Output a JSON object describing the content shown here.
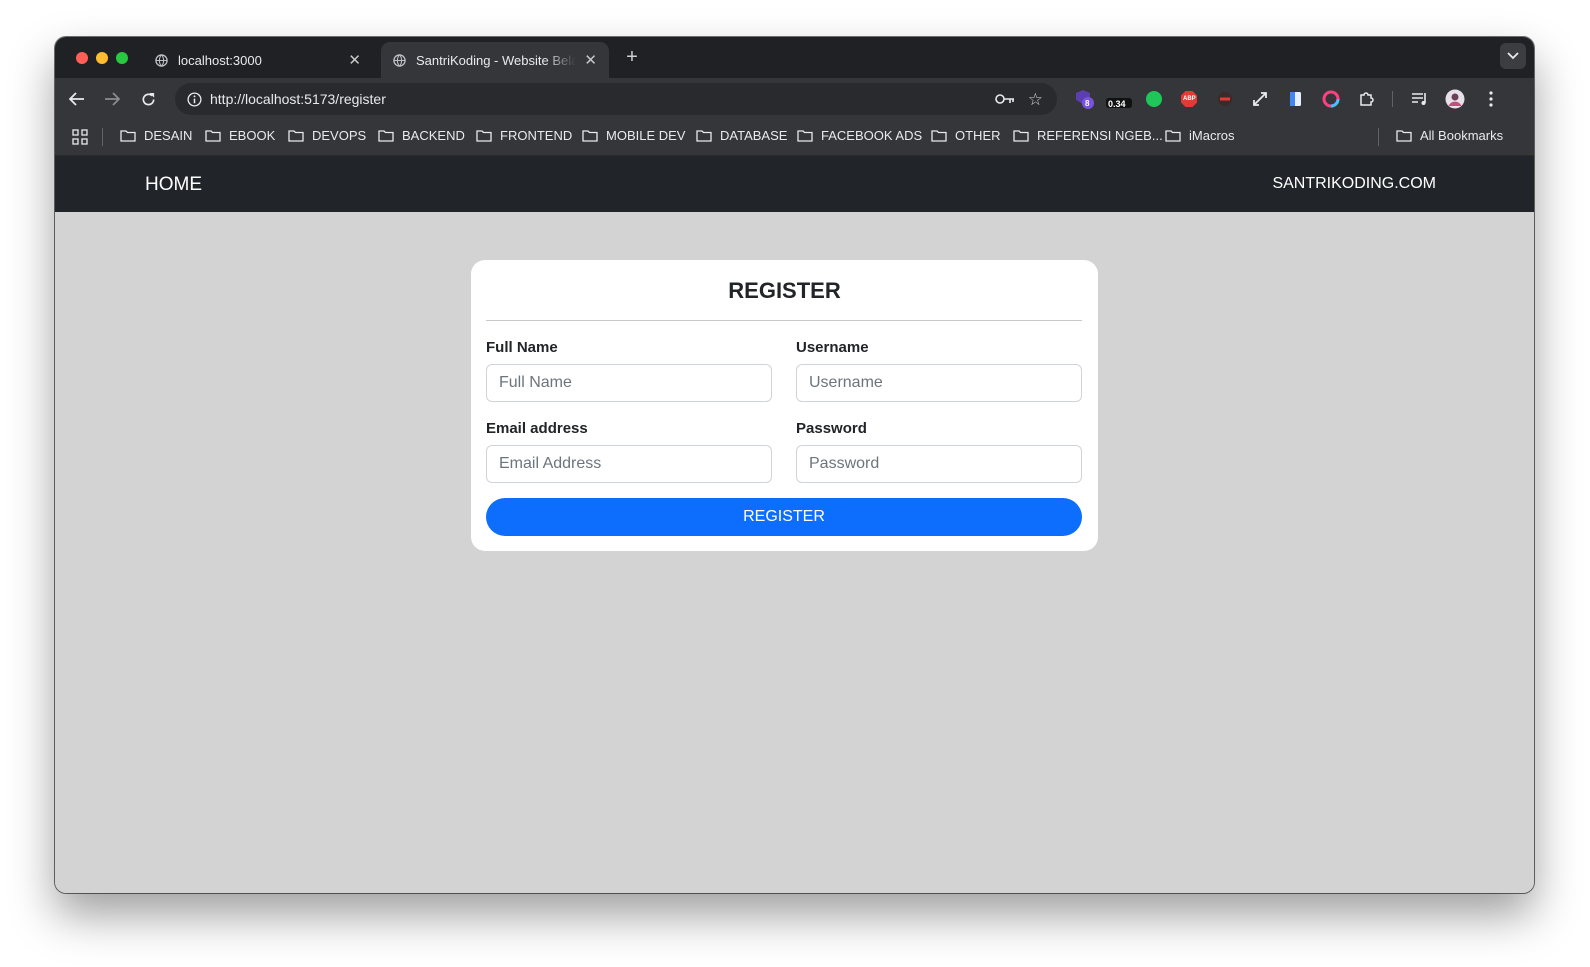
{
  "browser": {
    "tabs": [
      {
        "title": "localhost:3000",
        "active": false
      },
      {
        "title": "SantriKoding - Website Belajar",
        "active": true
      }
    ],
    "address_bar": {
      "url": "http://localhost:5173/register"
    },
    "extensions": {
      "badge_count": "8",
      "badge_value": "0.34",
      "abp_label": "ABP"
    },
    "bookmarks": [
      "DESAIN",
      "EBOOK",
      "DEVOPS",
      "BACKEND",
      "FRONTEND",
      "MOBILE DEV",
      "DATABASE",
      "FACEBOOK ADS",
      "OTHER",
      "REFERENSI NGEB...",
      "iMacros"
    ],
    "all_bookmarks": "All Bookmarks"
  },
  "navbar": {
    "home": "HOME",
    "brand": "SANTRIKODING.COM",
    "background": "#212529"
  },
  "form": {
    "title": "REGISTER",
    "fields": {
      "full_name": {
        "label": "Full Name",
        "placeholder": "Full Name",
        "value": ""
      },
      "username": {
        "label": "Username",
        "placeholder": "Username",
        "value": ""
      },
      "email": {
        "label": "Email address",
        "placeholder": "Email Address",
        "value": ""
      },
      "password": {
        "label": "Password",
        "placeholder": "Password",
        "value": ""
      }
    },
    "submit_label": "REGISTER",
    "submit_color": "#0d6efd"
  },
  "page": {
    "background": "#d3d3d3"
  },
  "icons": [
    "globe-icon",
    "close-icon",
    "plus-icon",
    "chevron-down-icon",
    "back-arrow-icon",
    "forward-arrow-icon",
    "reload-icon",
    "info-icon",
    "key-icon",
    "star-icon",
    "apps-grid-icon",
    "folder-icon",
    "puzzle-icon",
    "media-icon",
    "profile-avatar",
    "kebab-menu-icon"
  ]
}
